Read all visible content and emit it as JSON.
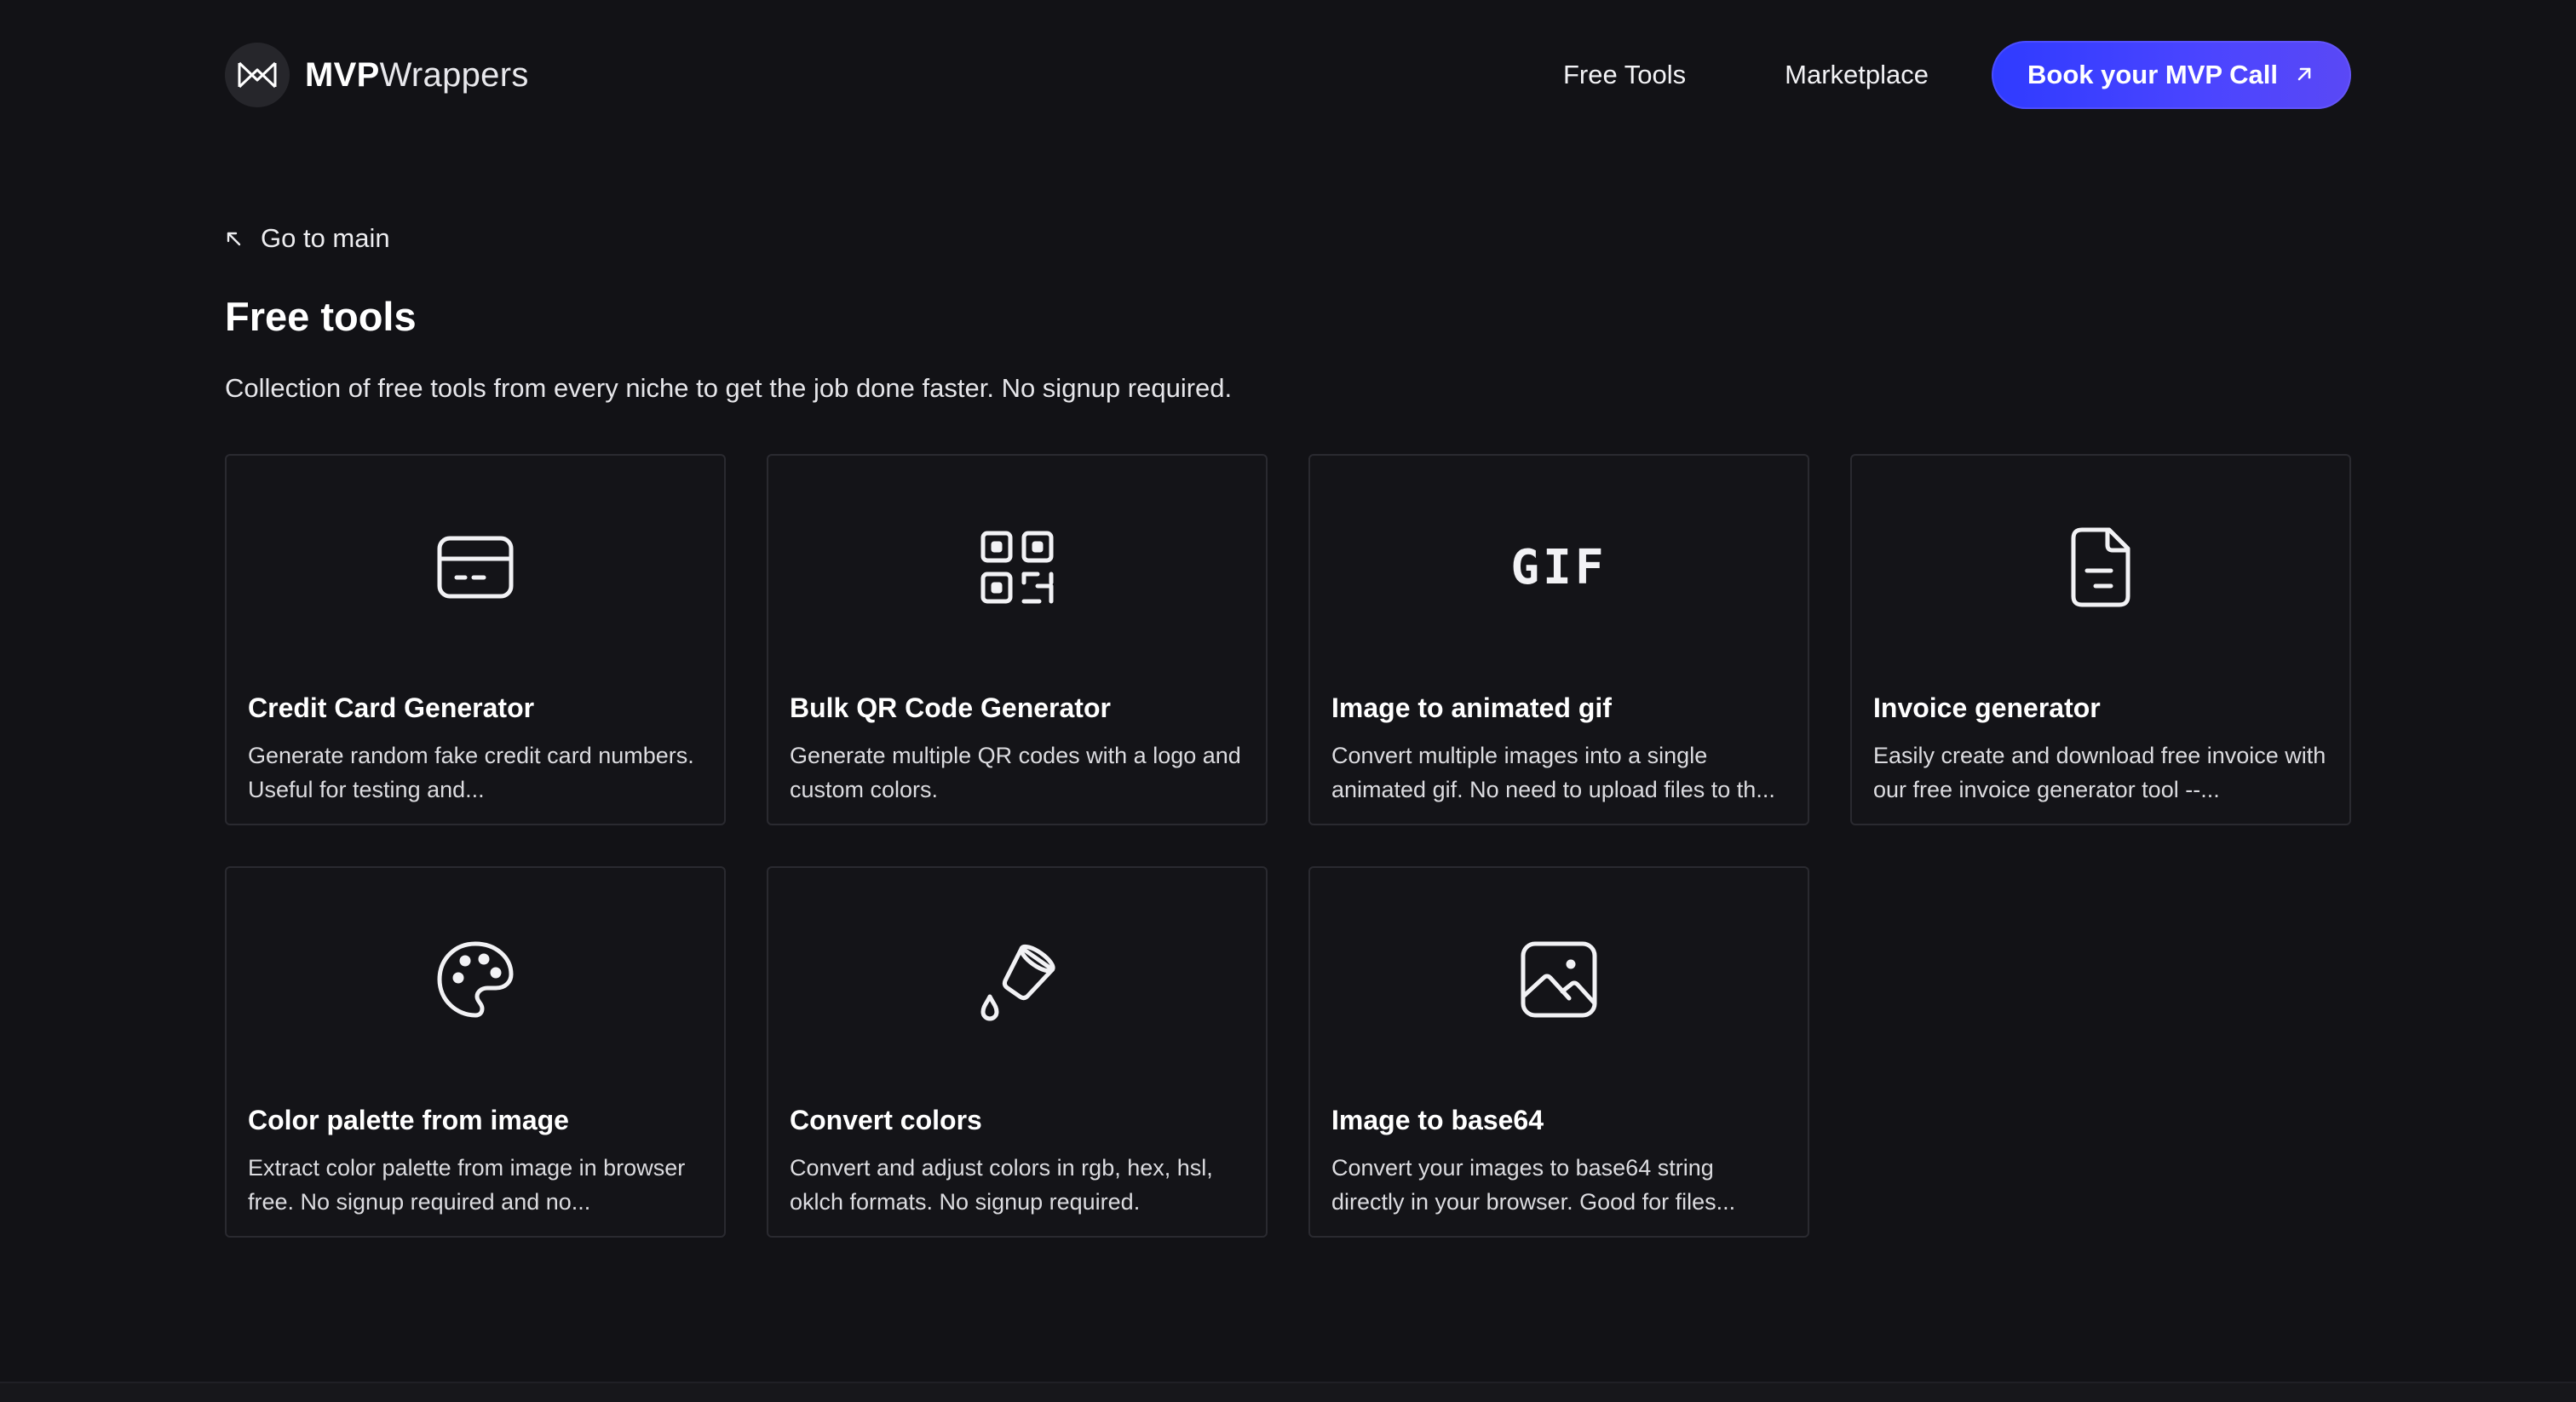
{
  "header": {
    "brand_bold": "MVP",
    "brand_light": "Wrappers",
    "nav": [
      {
        "label": "Free Tools"
      },
      {
        "label": "Marketplace"
      }
    ],
    "cta_label": "Book your MVP Call"
  },
  "back_link": "Go to main",
  "page": {
    "title": "Free tools",
    "description": "Collection of free tools from every niche to get the job done faster. No signup required."
  },
  "tools": [
    {
      "icon": "credit-card-icon",
      "title": "Credit Card Generator",
      "description": "Generate random fake credit card numbers. Useful for testing and..."
    },
    {
      "icon": "qr-code-icon",
      "title": "Bulk QR Code Generator",
      "description": "Generate multiple QR codes with a logo and custom colors."
    },
    {
      "icon": "gif-icon",
      "icon_text": "GIF",
      "title": "Image to animated gif",
      "description": "Convert multiple images into a single animated gif. No need to upload files to th..."
    },
    {
      "icon": "file-document-icon",
      "title": "Invoice generator",
      "description": "Easily create and download free invoice with our free invoice generator tool --..."
    },
    {
      "icon": "palette-icon",
      "title": "Color palette from image",
      "description": "Extract color palette from image in browser free. No signup required and no..."
    },
    {
      "icon": "paint-bucket-icon",
      "title": "Convert colors",
      "description": "Convert and adjust colors in rgb, hex, hsl, oklch formats. No signup required."
    },
    {
      "icon": "image-icon",
      "title": "Image to base64",
      "description": "Convert your images to base64 string directly in your browser. Good for files..."
    }
  ],
  "colors": {
    "background": "#121216",
    "card_border": "#2a2a30",
    "cta_gradient_start": "#2f3bff",
    "cta_gradient_end": "#5a48f5"
  }
}
